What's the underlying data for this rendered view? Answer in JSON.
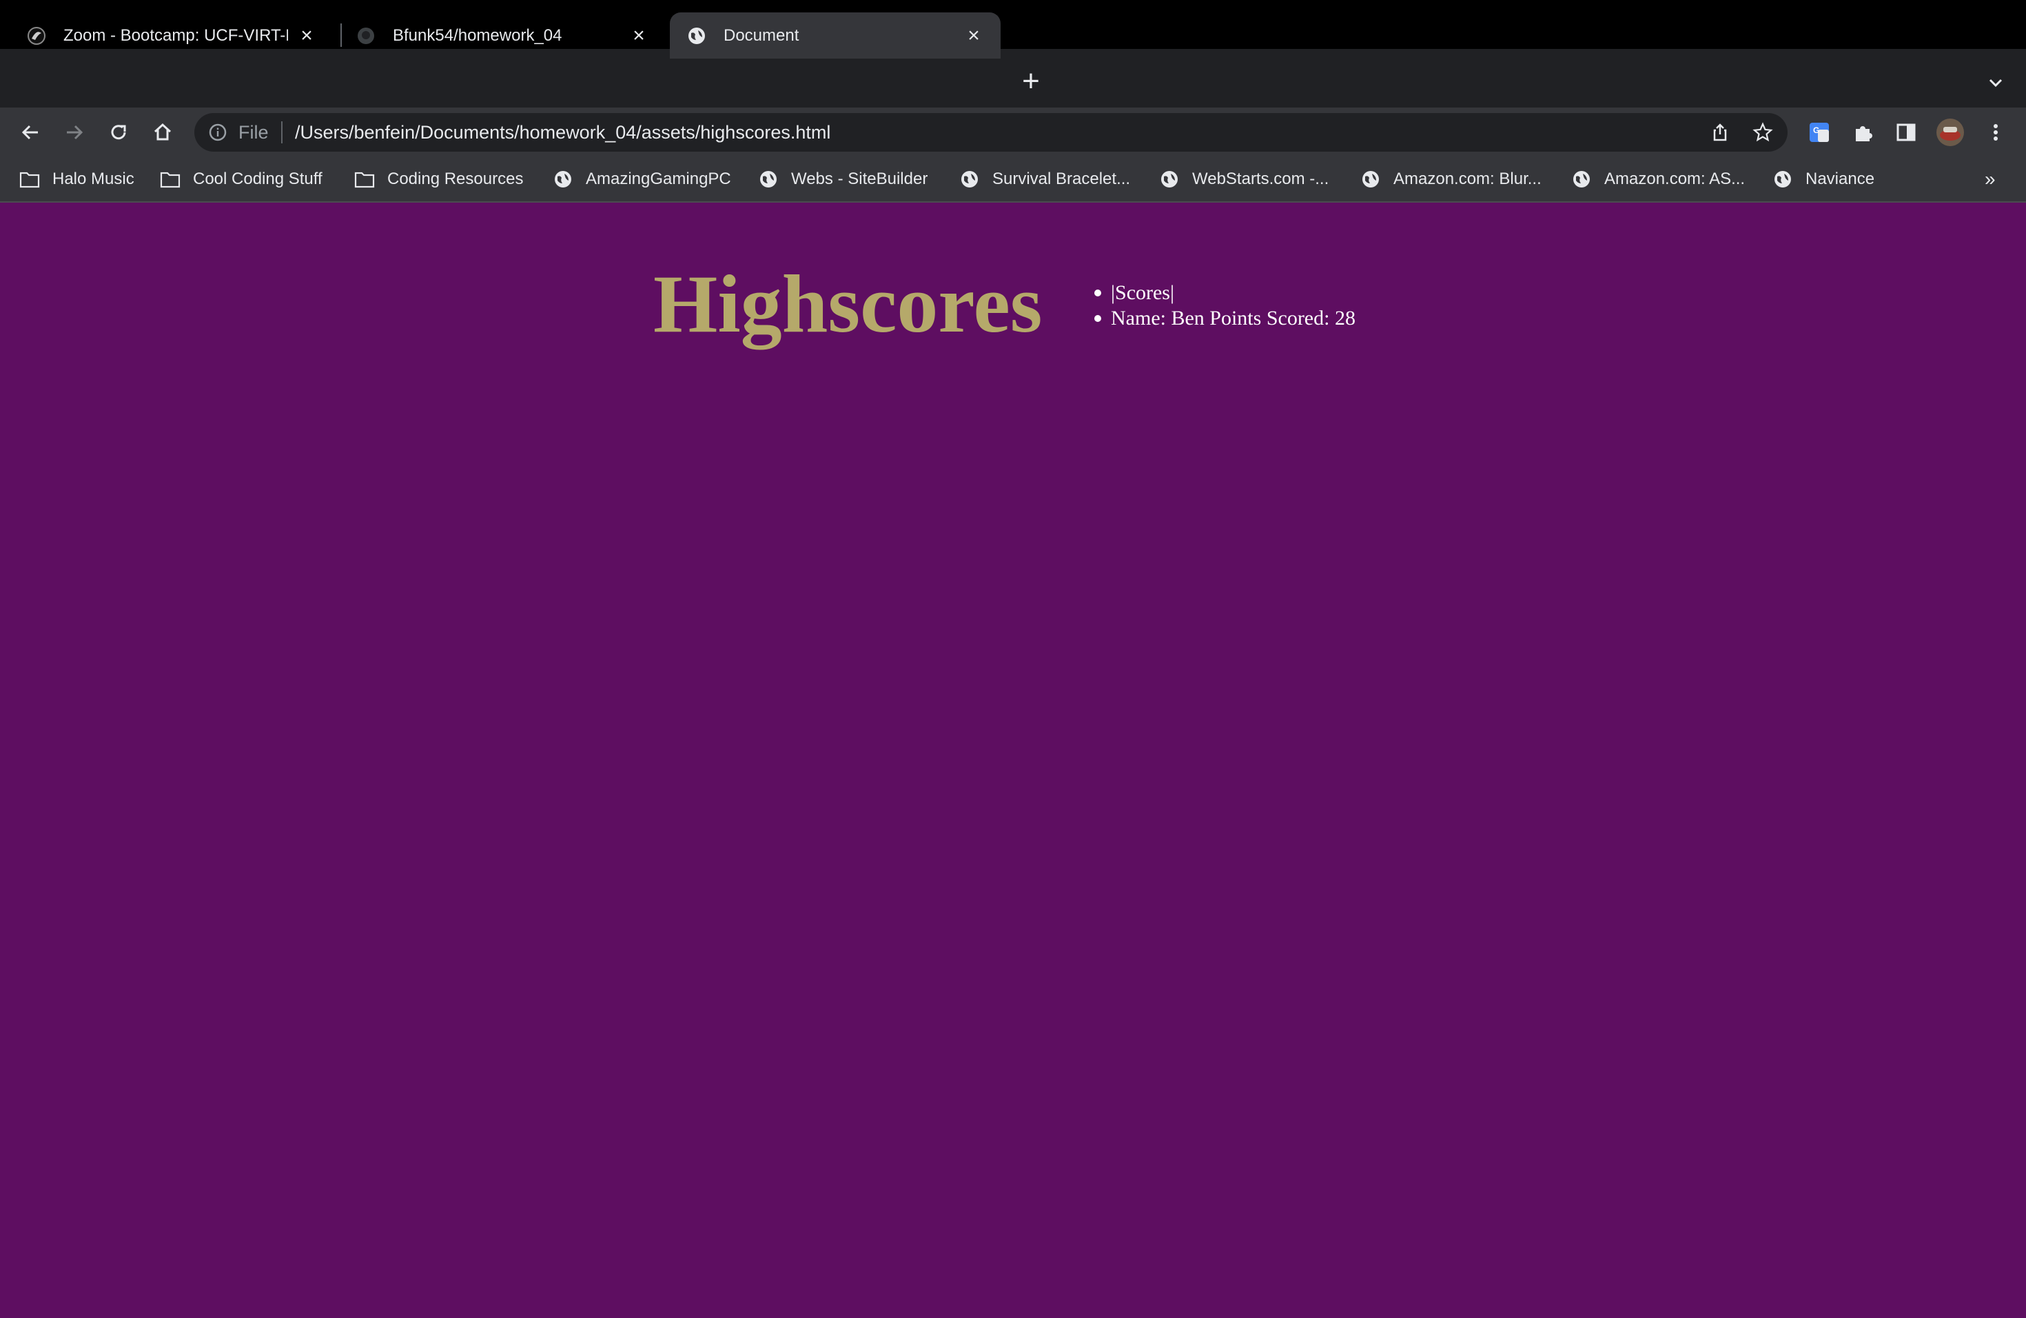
{
  "browser": {
    "tabs": [
      {
        "title": "Zoom - Bootcamp: UCF-VIRT-FSF",
        "icon": "zoom-icon",
        "active": false
      },
      {
        "title": "Bfunk54/homework_04",
        "icon": "github-icon",
        "active": false
      },
      {
        "title": "Document",
        "icon": "globe-icon",
        "active": true
      }
    ],
    "omnibox": {
      "scheme_label": "File",
      "url": "/Users/benfein/Documents/homework_04/assets/highscores.html"
    },
    "bookmarks": [
      {
        "label": "Halo Music",
        "icon": "folder-icon"
      },
      {
        "label": "Cool Coding Stuff",
        "icon": "folder-icon"
      },
      {
        "label": "Coding Resources",
        "icon": "folder-icon"
      },
      {
        "label": "AmazingGamingPC",
        "icon": "globe-icon"
      },
      {
        "label": "Webs - SiteBuilder",
        "icon": "globe-icon"
      },
      {
        "label": "Survival Bracelet...",
        "icon": "globe-icon"
      },
      {
        "label": "WebStarts.com -...",
        "icon": "globe-icon"
      },
      {
        "label": "Amazon.com: Blur...",
        "icon": "globe-icon"
      },
      {
        "label": "Amazon.com: AS...",
        "icon": "globe-icon"
      },
      {
        "label": "Naviance",
        "icon": "globe-icon"
      }
    ],
    "bookmarks_overflow": "»"
  },
  "page": {
    "title": "Highscores",
    "scores": [
      "|Scores|",
      "Name: Ben Points Scored: 28"
    ],
    "background_color": "#5e0e61",
    "title_color": "#b5a96a"
  }
}
